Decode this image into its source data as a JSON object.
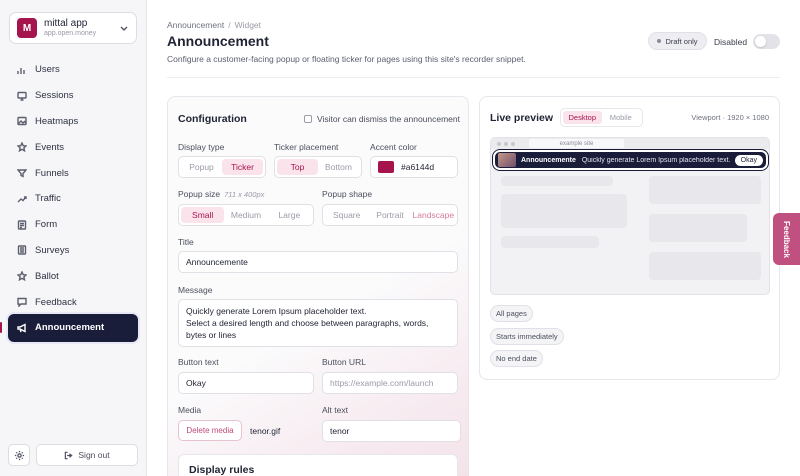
{
  "app": {
    "avatar_letter": "M",
    "name": "mittal app",
    "domain": "app.open.money"
  },
  "sidebar": {
    "items": [
      {
        "label": "Users",
        "icon": "bar-chart-icon"
      },
      {
        "label": "Sessions",
        "icon": "monitor-icon"
      },
      {
        "label": "Heatmaps",
        "icon": "image-icon"
      },
      {
        "label": "Events",
        "icon": "star-icon"
      },
      {
        "label": "Funnels",
        "icon": "filter-icon"
      },
      {
        "label": "Traffic",
        "icon": "trend-icon"
      },
      {
        "label": "Form",
        "icon": "form-icon"
      },
      {
        "label": "Surveys",
        "icon": "list-icon"
      },
      {
        "label": "Ballot",
        "icon": "star-icon"
      },
      {
        "label": "Feedback",
        "icon": "chat-icon"
      },
      {
        "label": "Announcement",
        "icon": "megaphone-icon",
        "active": true
      }
    ],
    "sign_out": "Sign out"
  },
  "header": {
    "breadcrumb": [
      "Announcement",
      "Widget"
    ],
    "title": "Announcement",
    "description": "Configure a customer-facing popup or floating ticker for pages using this site's recorder snippet.",
    "status_badge": "Draft only",
    "toggle_label": "Disabled",
    "toggle_on": false
  },
  "config": {
    "title": "Configuration",
    "dismiss_label": "Visitor can dismiss the announcement",
    "display_type": {
      "label": "Display type",
      "options": [
        "Popup",
        "Ticker"
      ],
      "selected": "Ticker"
    },
    "ticker_placement": {
      "label": "Ticker placement",
      "options": [
        "Top",
        "Bottom"
      ],
      "selected": "Top"
    },
    "accent_color": {
      "label": "Accent color",
      "value": "#a6144d"
    },
    "popup_size": {
      "label": "Popup size",
      "hint": "711 x 400px",
      "options": [
        "Small",
        "Medium",
        "Large"
      ],
      "selected": "Small"
    },
    "popup_shape": {
      "label": "Popup shape",
      "options": [
        "Square",
        "Portrait",
        "Landscape"
      ],
      "selected": "Landscape"
    },
    "title_field": {
      "label": "Title",
      "value": "Announcemente"
    },
    "message": {
      "label": "Message",
      "value": "Quickly generate Lorem Ipsum placeholder text.\nSelect a desired length and choose between paragraphs, words, bytes or lines"
    },
    "button_text": {
      "label": "Button text",
      "value": "Okay"
    },
    "button_url": {
      "label": "Button URL",
      "placeholder": "https://example.com/launch"
    },
    "media": {
      "label": "Media",
      "delete_label": "Delete media",
      "file": "tenor.gif"
    },
    "alt_text": {
      "label": "Alt text",
      "value": "tenor"
    },
    "display_rules_title": "Display rules"
  },
  "preview": {
    "title": "Live preview",
    "modes": [
      "Desktop",
      "Mobile"
    ],
    "selected_mode": "Desktop",
    "viewport": "Viewport · 1920 × 1080",
    "site_label": "example site",
    "ticker": {
      "title": "Announcemente",
      "message": "Quickly generate Lorem Ipsum placeholder text. Sel...",
      "button": "Okay"
    },
    "chips": [
      "All pages",
      "Starts immediately",
      "No end date"
    ]
  },
  "feedback_tab": "Feedback",
  "colors": {
    "accent": "#a6144d",
    "nav_active": "#1a1d3a"
  }
}
